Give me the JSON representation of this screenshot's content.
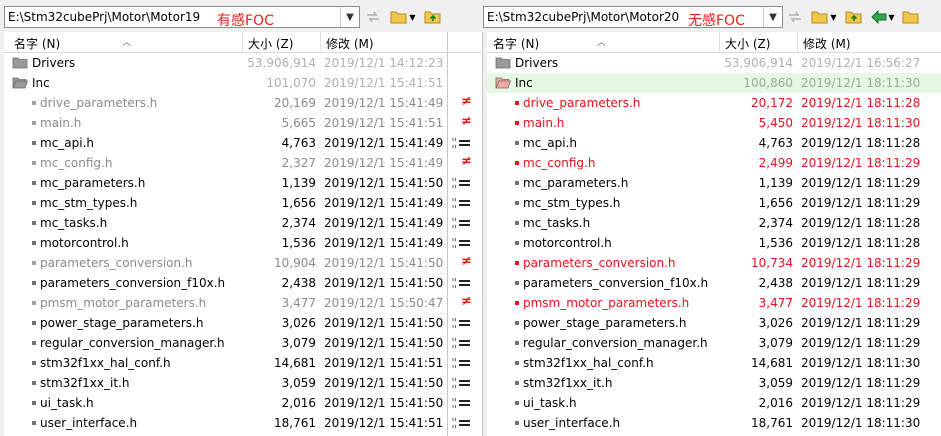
{
  "left": {
    "path": "E:\\Stm32cubePrj\\Motor\\Motor19",
    "tag": "有感FOC",
    "columns": {
      "name": "名字 (N)",
      "size": "大小 (Z)",
      "modified": "修改 (M)"
    },
    "rows": [
      {
        "type": "folder",
        "name": "Drivers",
        "size": "53,906,914",
        "date": "2019/12/1 14:12:23",
        "status": "folder"
      },
      {
        "type": "folder-open",
        "name": "Inc",
        "size": "101,070",
        "date": "2019/12/1 15:41:51",
        "status": "folder"
      },
      {
        "type": "file",
        "name": "drive_parameters.h",
        "size": "20,169",
        "date": "2019/12/1 15:41:49",
        "status": "diff"
      },
      {
        "type": "file",
        "name": "main.h",
        "size": "5,665",
        "date": "2019/12/1 15:41:51",
        "status": "diff"
      },
      {
        "type": "file",
        "name": "mc_api.h",
        "size": "4,763",
        "date": "2019/12/1 15:41:49",
        "status": "same"
      },
      {
        "type": "file",
        "name": "mc_config.h",
        "size": "2,327",
        "date": "2019/12/1 15:41:49",
        "status": "same-dim"
      },
      {
        "type": "file",
        "name": "mc_parameters.h",
        "size": "1,139",
        "date": "2019/12/1 15:41:50",
        "status": "same"
      },
      {
        "type": "file",
        "name": "mc_stm_types.h",
        "size": "1,656",
        "date": "2019/12/1 15:41:49",
        "status": "same"
      },
      {
        "type": "file",
        "name": "mc_tasks.h",
        "size": "2,374",
        "date": "2019/12/1 15:41:49",
        "status": "same"
      },
      {
        "type": "file",
        "name": "motorcontrol.h",
        "size": "1,536",
        "date": "2019/12/1 15:41:49",
        "status": "same"
      },
      {
        "type": "file",
        "name": "parameters_conversion.h",
        "size": "10,904",
        "date": "2019/12/1 15:41:50",
        "status": "diff"
      },
      {
        "type": "file",
        "name": "parameters_conversion_f10x.h",
        "size": "2,438",
        "date": "2019/12/1 15:41:50",
        "status": "same"
      },
      {
        "type": "file",
        "name": "pmsm_motor_parameters.h",
        "size": "3,477",
        "date": "2019/12/1 15:50:47",
        "status": "diff"
      },
      {
        "type": "file",
        "name": "power_stage_parameters.h",
        "size": "3,026",
        "date": "2019/12/1 15:41:50",
        "status": "same"
      },
      {
        "type": "file",
        "name": "regular_conversion_manager.h",
        "size": "3,079",
        "date": "2019/12/1 15:41:50",
        "status": "same"
      },
      {
        "type": "file",
        "name": "stm32f1xx_hal_conf.h",
        "size": "14,681",
        "date": "2019/12/1 15:41:51",
        "status": "same"
      },
      {
        "type": "file",
        "name": "stm32f1xx_it.h",
        "size": "3,059",
        "date": "2019/12/1 15:41:50",
        "status": "same"
      },
      {
        "type": "file",
        "name": "ui_task.h",
        "size": "2,016",
        "date": "2019/12/1 15:41:50",
        "status": "same"
      },
      {
        "type": "file",
        "name": "user_interface.h",
        "size": "18,761",
        "date": "2019/12/1 15:41:51",
        "status": "same"
      }
    ]
  },
  "right": {
    "path": "E:\\Stm32cubePrj\\Motor\\Motor20",
    "tag": "无感FOC",
    "columns": {
      "name": "名字 (N)",
      "size": "大小 (Z)",
      "modified": "修改 (M)"
    },
    "rows": [
      {
        "type": "folder",
        "name": "Drivers",
        "size": "53,906,914",
        "date": "2019/12/1 16:56:27",
        "status": "folder"
      },
      {
        "type": "folder-open",
        "name": "Inc",
        "size": "100,860",
        "date": "2019/12/1 18:11:30",
        "status": "folder-diff"
      },
      {
        "type": "file",
        "name": "drive_parameters.h",
        "size": "20,172",
        "date": "2019/12/1 18:11:28",
        "status": "diff"
      },
      {
        "type": "file",
        "name": "main.h",
        "size": "5,450",
        "date": "2019/12/1 18:11:30",
        "status": "diff"
      },
      {
        "type": "file",
        "name": "mc_api.h",
        "size": "4,763",
        "date": "2019/12/1 18:11:28",
        "status": "same"
      },
      {
        "type": "file",
        "name": "mc_config.h",
        "size": "2,499",
        "date": "2019/12/1 18:11:29",
        "status": "diff"
      },
      {
        "type": "file",
        "name": "mc_parameters.h",
        "size": "1,139",
        "date": "2019/12/1 18:11:29",
        "status": "same"
      },
      {
        "type": "file",
        "name": "mc_stm_types.h",
        "size": "1,656",
        "date": "2019/12/1 18:11:29",
        "status": "same"
      },
      {
        "type": "file",
        "name": "mc_tasks.h",
        "size": "2,374",
        "date": "2019/12/1 18:11:28",
        "status": "same"
      },
      {
        "type": "file",
        "name": "motorcontrol.h",
        "size": "1,536",
        "date": "2019/12/1 18:11:28",
        "status": "same"
      },
      {
        "type": "file",
        "name": "parameters_conversion.h",
        "size": "10,734",
        "date": "2019/12/1 18:11:29",
        "status": "diff"
      },
      {
        "type": "file",
        "name": "parameters_conversion_f10x.h",
        "size": "2,438",
        "date": "2019/12/1 18:11:29",
        "status": "same"
      },
      {
        "type": "file",
        "name": "pmsm_motor_parameters.h",
        "size": "3,477",
        "date": "2019/12/1 18:11:29",
        "status": "diff"
      },
      {
        "type": "file",
        "name": "power_stage_parameters.h",
        "size": "3,026",
        "date": "2019/12/1 18:11:29",
        "status": "same"
      },
      {
        "type": "file",
        "name": "regular_conversion_manager.h",
        "size": "3,079",
        "date": "2019/12/1 18:11:29",
        "status": "same"
      },
      {
        "type": "file",
        "name": "stm32f1xx_hal_conf.h",
        "size": "14,681",
        "date": "2019/12/1 18:11:30",
        "status": "same"
      },
      {
        "type": "file",
        "name": "stm32f1xx_it.h",
        "size": "3,059",
        "date": "2019/12/1 18:11:29",
        "status": "same"
      },
      {
        "type": "file",
        "name": "ui_task.h",
        "size": "2,016",
        "date": "2019/12/1 18:11:29",
        "status": "same"
      },
      {
        "type": "file",
        "name": "user_interface.h",
        "size": "18,761",
        "date": "2019/12/1 18:11:30",
        "status": "same"
      }
    ]
  },
  "colors": {
    "diff": "#e4121b",
    "dim": "#8a8a8a",
    "folder": "#e8c25a",
    "highlight": "#e6f8e3"
  }
}
